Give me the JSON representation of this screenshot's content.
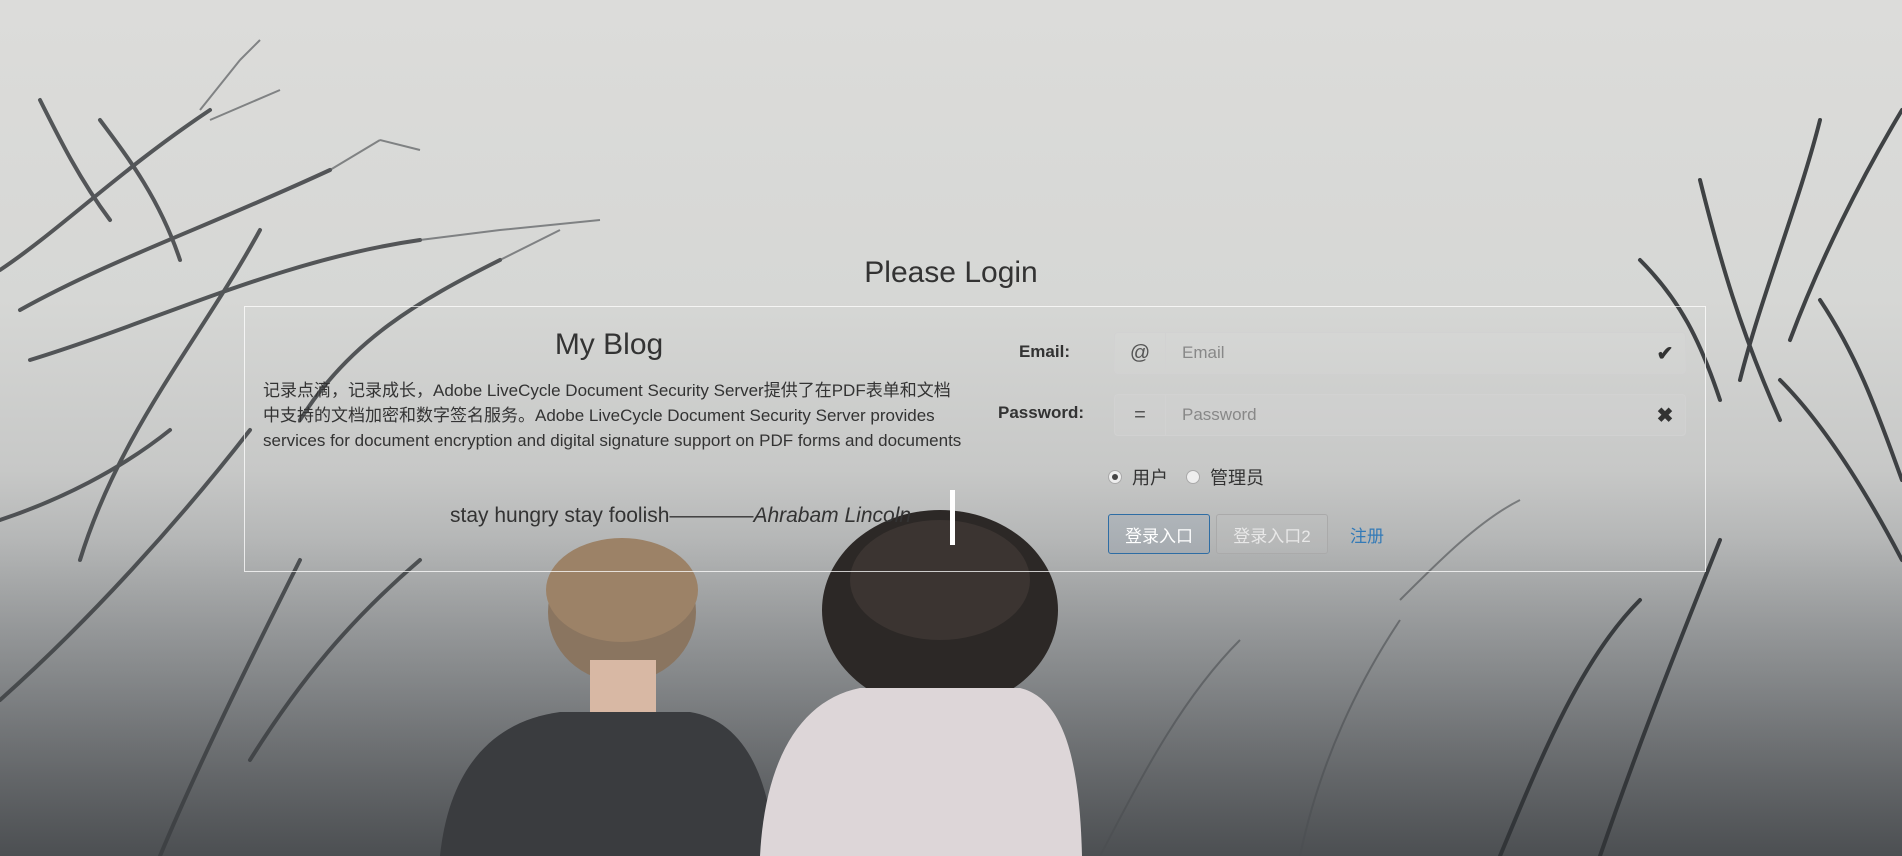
{
  "page": {
    "title": "Please Login"
  },
  "blog": {
    "title": "My Blog",
    "description": "记录点滴，记录成长，Adobe LiveCycle Document Security Server提供了在PDF表单和文档中支持的文档加密和数字签名服务。Adobe LiveCycle Document Security Server provides services for document encryption and digital signature support on PDF forms and documents",
    "quote_text": "stay hungry stay foolish",
    "quote_dash": "————",
    "quote_author": "Ahrabam Lincoln"
  },
  "form": {
    "email_label": "Email:",
    "email_addon": "@",
    "email_placeholder": "Email",
    "email_feedback": "✔",
    "password_label": "Password:",
    "password_addon": "=",
    "password_placeholder": "Password",
    "password_feedback": "✖",
    "roles": [
      {
        "label": "用户",
        "checked": true
      },
      {
        "label": "管理员",
        "checked": false
      }
    ],
    "login_button": "登录入口",
    "login_button2": "登录入口2",
    "register_link": "注册"
  },
  "colors": {
    "primary_border": "#2e6da4",
    "link": "#337ab7",
    "panel_border": "#ffffff"
  },
  "icons": {
    "email_addon": "at-icon",
    "password_addon": "equals-icon",
    "email_feedback": "check-icon",
    "password_feedback": "x-icon"
  }
}
